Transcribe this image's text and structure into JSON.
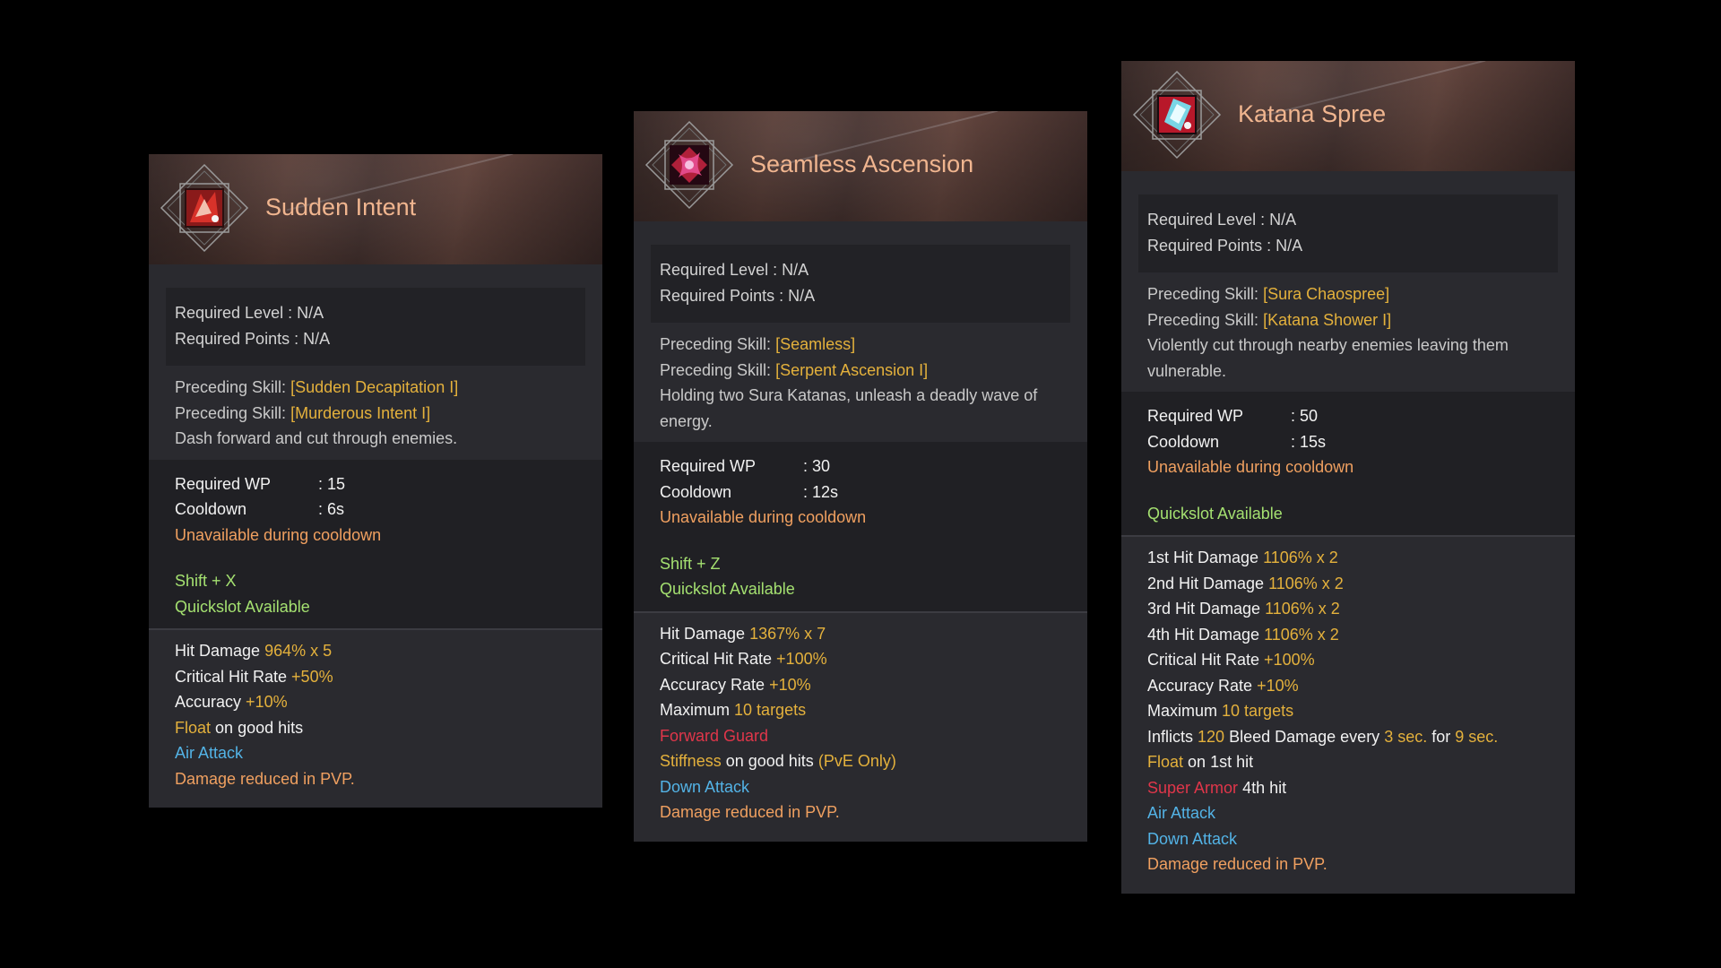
{
  "cards": [
    {
      "name": "Sudden Intent",
      "required_level": "Required Level : N/A",
      "required_points": "Required Points : N/A",
      "preceding_label": "Preceding Skill:",
      "preceding": [
        "[Sudden Decapitation I]",
        "[Murderous Intent I]"
      ],
      "description": "Dash forward and cut through enemies.",
      "wp_label": "Required WP",
      "wp_value": ": 15",
      "cooldown_label": "Cooldown",
      "cooldown_value": ": 6s",
      "cooldown_note": "Unavailable during cooldown",
      "shortcut": "Shift + X",
      "quickslot": "Quickslot Available",
      "hit_damage_label": "Hit Damage",
      "hit_damage_value": "964% x 5",
      "crit_label": "Critical Hit Rate",
      "crit_value": "+50%",
      "acc_label": "Accuracy",
      "acc_value": "+10%",
      "float_word": "Float",
      "float_rest": "on good hits",
      "air_attack": "Air Attack",
      "pvp_note": "Damage reduced in PVP."
    },
    {
      "name": "Seamless Ascension",
      "required_level": "Required Level : N/A",
      "required_points": "Required Points : N/A",
      "preceding_label": "Preceding Skill:",
      "preceding": [
        "[Seamless]",
        "[Serpent Ascension I]"
      ],
      "description": "Holding two Sura Katanas, unleash a deadly wave of energy.",
      "wp_label": "Required WP",
      "wp_value": ": 30",
      "cooldown_label": "Cooldown",
      "cooldown_value": ": 12s",
      "cooldown_note": "Unavailable during cooldown",
      "shortcut": "Shift + Z",
      "quickslot": "Quickslot Available",
      "hit_damage_label": "Hit Damage",
      "hit_damage_value": "1367% x 7",
      "crit_label": "Critical Hit Rate",
      "crit_value": "+100%",
      "acc_label": "Accuracy Rate",
      "acc_value": "+10%",
      "max_label": "Maximum",
      "max_value": "10 targets",
      "forward_guard": "Forward Guard",
      "stiffness_word": "Stiffness",
      "stiffness_rest": "on good hits",
      "stiffness_note": "(PvE Only)",
      "down_attack": "Down Attack",
      "pvp_note": "Damage reduced in PVP."
    },
    {
      "name": "Katana Spree",
      "required_level": "Required Level : N/A",
      "required_points": "Required Points : N/A",
      "preceding_label": "Preceding Skill:",
      "preceding": [
        "[Sura Chaospree]",
        "[Katana Shower I]"
      ],
      "description": "Violently cut through nearby enemies leaving them vulnerable.",
      "wp_label": "Required WP",
      "wp_value": ": 50",
      "cooldown_label": "Cooldown",
      "cooldown_value": ": 15s",
      "cooldown_note": "Unavailable during cooldown",
      "quickslot": "Quickslot Available",
      "hits": [
        {
          "label": "1st Hit Damage",
          "value": "1106% x 2"
        },
        {
          "label": "2nd Hit Damage",
          "value": "1106% x 2"
        },
        {
          "label": "3rd Hit Damage",
          "value": "1106% x 2"
        },
        {
          "label": "4th Hit Damage",
          "value": "1106% x 2"
        }
      ],
      "crit_label": "Critical Hit Rate",
      "crit_value": "+100%",
      "acc_label": "Accuracy Rate",
      "acc_value": "+10%",
      "max_label": "Maximum",
      "max_value": "10 targets",
      "bleed_prefix": "Inflicts",
      "bleed_amount": "120",
      "bleed_mid": "Bleed Damage every",
      "bleed_interval": "3 sec.",
      "bleed_for": "for",
      "bleed_duration": "9 sec.",
      "float_word": "Float",
      "float_rest": "on 1st hit",
      "super_armor_word": "Super Armor",
      "super_armor_rest": "4th hit",
      "air_attack": "Air Attack",
      "down_attack": "Down Attack",
      "pvp_note": "Damage reduced in PVP."
    }
  ],
  "icons": [
    "sudden-intent-skill-icon",
    "seamless-ascension-skill-icon",
    "katana-spree-skill-icon"
  ],
  "colors": {
    "title": "#f0b58f",
    "skill_link": "#e4b13c",
    "warning": "#f0a060",
    "available": "#a4e070",
    "attack_type": "#53b3e6",
    "special": "#e0364a",
    "panel": "#2a2a2f"
  }
}
